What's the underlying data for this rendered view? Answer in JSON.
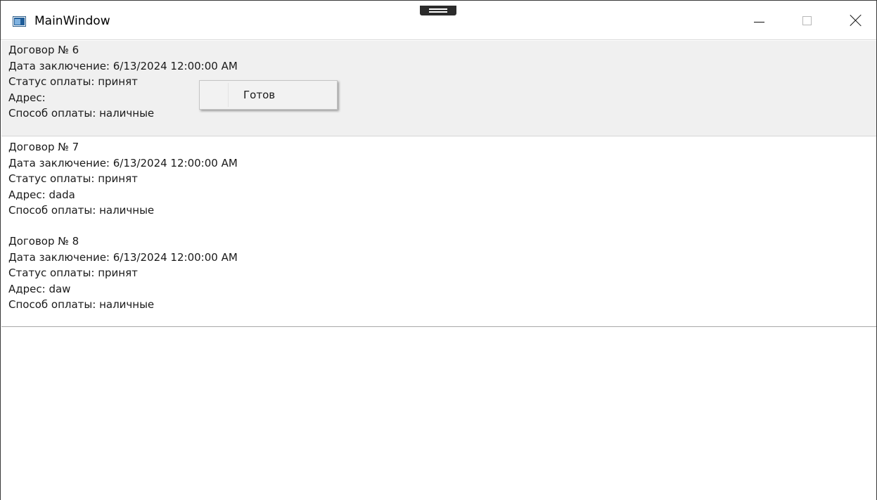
{
  "window": {
    "title": "MainWindow"
  },
  "orders": [
    {
      "number": "Договор № 6",
      "date": "Дата заключение: 6/13/2024 12:00:00 AM",
      "status": "Статус оплаты: принят",
      "address": "Адрес:",
      "payment": "Способ оплаты: наличные"
    },
    {
      "number": "Договор № 7",
      "date": "Дата заключение: 6/13/2024 12:00:00 AM",
      "status": "Статус оплаты: принят",
      "address": "Адрес: dada",
      "payment": "Способ оплаты: наличные"
    },
    {
      "number": "Договор № 8",
      "date": "Дата заключение: 6/13/2024 12:00:00 AM",
      "status": "Статус оплаты: принят",
      "address": "Адрес: daw",
      "payment": "Способ оплаты: наличные"
    }
  ],
  "context_menu": {
    "items": [
      {
        "label": "Готов"
      }
    ]
  },
  "colors": {
    "selected_row": "#f0f0f0",
    "menu_background": "#f2f2f2"
  }
}
